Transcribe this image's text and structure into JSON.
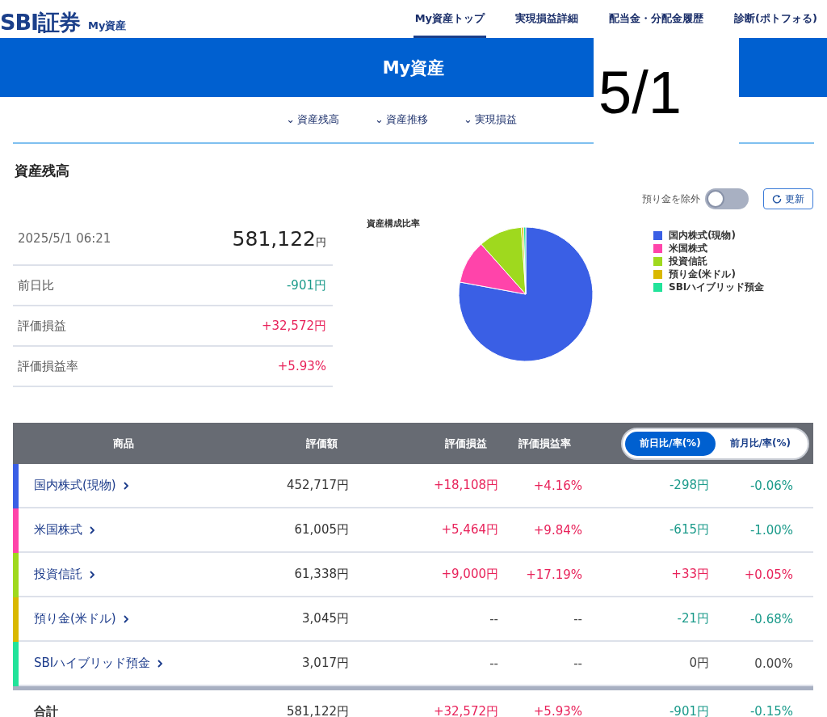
{
  "header": {
    "logo": "SBI証券",
    "subtitle": "My資産",
    "nav": [
      {
        "label": "My資産トップ",
        "selected": true
      },
      {
        "label": "実現損益詳細",
        "selected": false
      },
      {
        "label": "配当金・分配金履歴",
        "selected": false
      },
      {
        "label": "診断(ポトフォる)",
        "selected": false
      }
    ]
  },
  "banner": {
    "title": "My資産"
  },
  "anchors": [
    {
      "caret": "⌄",
      "label": "資産残高"
    },
    {
      "caret": "⌄",
      "label": "資産推移"
    },
    {
      "caret": "⌄",
      "label": "実現損益"
    }
  ],
  "overlay_label": "5/1",
  "section_title": "資産残高",
  "exclude_switch": {
    "label": "預り金を除外",
    "on": false
  },
  "refresh_button": "更新",
  "summary": {
    "timestamp": "2025/5/1 06:21",
    "total": "581,122",
    "currency": "円",
    "rows": [
      {
        "label": "前日比",
        "value": "-901円",
        "color": "#1a9a8a"
      },
      {
        "label": "評価損益",
        "value": "+32,572円",
        "color": "#e8225a"
      },
      {
        "label": "評価損益率",
        "value": "+5.93%",
        "color": "#e8225a"
      }
    ]
  },
  "chart": {
    "chart_data": {
      "type": "pie",
      "title": "資産構成比率",
      "categories": [
        "国内株式(現物)",
        "米国株式",
        "投資信託",
        "預り金(米ドル)",
        "SBIハイブリッド預金"
      ],
      "values": [
        77.9,
        10.5,
        10.56,
        0.52,
        0.52
      ]
    }
  },
  "table": {
    "columns": [
      "商品",
      "評価額",
      "評価損益",
      "評価損益率"
    ],
    "compare_tabs": [
      {
        "label": "前日比/率(%)",
        "selected": true
      },
      {
        "label": "前月比/率(%)",
        "selected": false
      }
    ],
    "rows": [
      {
        "name": "国内株式(現物)",
        "color": "#3a5fe5",
        "amount": "452,717円",
        "pl": {
          "text": "+18,108円",
          "color": "#e8225a"
        },
        "pl_rate": {
          "text": "+4.16%",
          "color": "#e8225a"
        },
        "change": {
          "text": "-298円",
          "color": "#1a9a8a"
        },
        "change_rate": {
          "text": "-0.06%",
          "color": "#1a9a8a"
        }
      },
      {
        "name": "米国株式",
        "color": "#ff44aa",
        "amount": "61,005円",
        "pl": {
          "text": "+5,464円",
          "color": "#e8225a"
        },
        "pl_rate": {
          "text": "+9.84%",
          "color": "#e8225a"
        },
        "change": {
          "text": "-615円",
          "color": "#1a9a8a"
        },
        "change_rate": {
          "text": "-1.00%",
          "color": "#1a9a8a"
        }
      },
      {
        "name": "投資信託",
        "color": "#9fd91e",
        "amount": "61,338円",
        "pl": {
          "text": "+9,000円",
          "color": "#e8225a"
        },
        "pl_rate": {
          "text": "+17.19%",
          "color": "#e8225a"
        },
        "change": {
          "text": "+33円",
          "color": "#e8225a"
        },
        "change_rate": {
          "text": "+0.05%",
          "color": "#e8225a"
        }
      },
      {
        "name": "預り金(米ドル)",
        "color": "#d9b800",
        "amount": "3,045円",
        "pl": {
          "text": "--",
          "color": "#444444"
        },
        "pl_rate": {
          "text": "--",
          "color": "#444444"
        },
        "change": {
          "text": "-21円",
          "color": "#1a9a8a"
        },
        "change_rate": {
          "text": "-0.68%",
          "color": "#1a9a8a"
        }
      },
      {
        "name": "SBIハイブリッド預金",
        "color": "#22e39a",
        "amount": "3,017円",
        "pl": {
          "text": "--",
          "color": "#444444"
        },
        "pl_rate": {
          "text": "--",
          "color": "#444444"
        },
        "change": {
          "text": "0円",
          "color": "#444444"
        },
        "change_rate": {
          "text": "0.00%",
          "color": "#444444"
        }
      }
    ],
    "total": {
      "name": "合計",
      "amount": "581,122円",
      "pl": {
        "text": "+32,572円",
        "color": "#e8225a"
      },
      "pl_rate": {
        "text": "+5.93%",
        "color": "#e8225a"
      },
      "change": {
        "text": "-901円",
        "color": "#1a9a8a"
      },
      "change_rate": {
        "text": "-0.15%",
        "color": "#1a9a8a"
      }
    }
  }
}
